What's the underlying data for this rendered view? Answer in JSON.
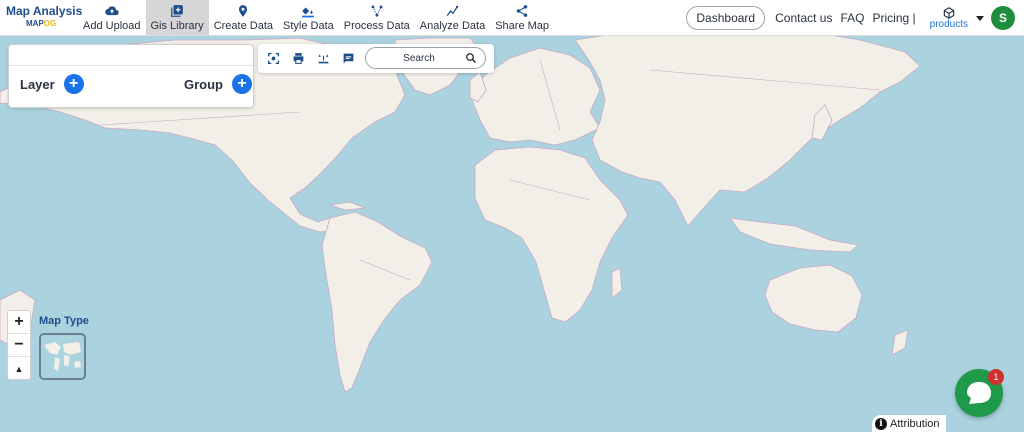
{
  "brand": {
    "title": "Map Analysis",
    "sub_main": "MAP",
    "sub_accent": "OG"
  },
  "nav": [
    {
      "label": "Add Upload",
      "icon": "cloud-upload-icon"
    },
    {
      "label": "Gis Library",
      "icon": "library-add-icon",
      "active": true
    },
    {
      "label": "Create Data",
      "icon": "map-pin-icon"
    },
    {
      "label": "Style Data",
      "icon": "paint-bucket-icon"
    },
    {
      "label": "Process Data",
      "icon": "process-nodes-icon"
    },
    {
      "label": "Analyze Data",
      "icon": "analytics-line-icon"
    },
    {
      "label": "Share Map",
      "icon": "share-icon"
    }
  ],
  "header_right": {
    "dashboard": "Dashboard",
    "contact": "Contact us",
    "faq": "FAQ",
    "pricing": "Pricing |",
    "products": "products",
    "avatar_initial": "S"
  },
  "layer_panel": {
    "layer_label": "Layer",
    "group_label": "Group",
    "add_symbol": "+"
  },
  "toolbar": {
    "icons": [
      "screenshot-focus-icon",
      "print-icon",
      "measure-icon",
      "comment-icon"
    ],
    "search_placeholder": "Search"
  },
  "map_controls": {
    "zoom_in": "+",
    "zoom_out": "−",
    "reset": "▲",
    "map_type_label": "Map Type"
  },
  "chat": {
    "badge_count": "1"
  },
  "attribution": {
    "icon": "i",
    "label": "Attribution"
  },
  "colors": {
    "ocean": "#aad3df",
    "land": "#f2efe9",
    "border": "#c9a9c4",
    "accent": "#1a73e8",
    "chat": "#1e9a4a"
  }
}
